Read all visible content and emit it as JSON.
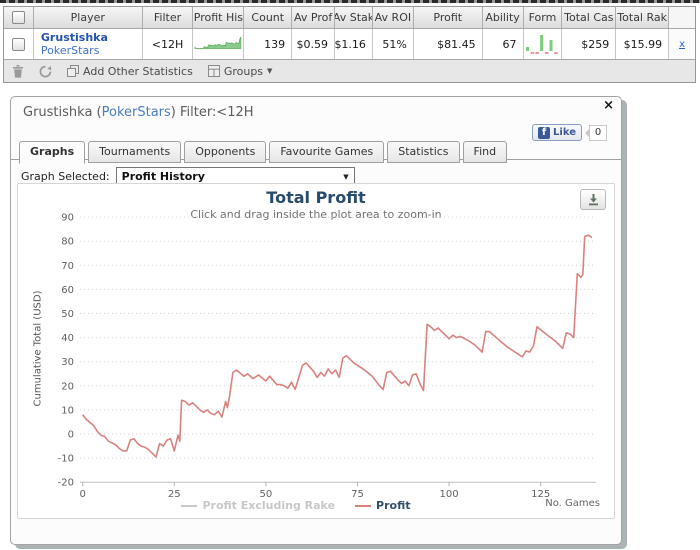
{
  "table": {
    "columns": [
      "Player",
      "Filter",
      "Profit His",
      "Count",
      "Av Prof",
      "Av Stak",
      "Av ROI",
      "Profit",
      "Ability",
      "Form",
      "Total Cas",
      "Total Rak"
    ],
    "row": {
      "player_name": "Grustishka",
      "player_site": "PokerStars",
      "filter": "<12H",
      "count": "139",
      "av_prof": "$0.59",
      "av_stak": "$1.16",
      "av_roi": "51%",
      "profit": "$81.45",
      "ability": "67",
      "total_cas": "$259",
      "total_rak": "$15.99",
      "remove_label": "x"
    },
    "form": [
      4,
      -2,
      -2,
      16,
      -2,
      11,
      -2
    ],
    "toolbar": {
      "add_other_statistics_label": "Add Other Statistics",
      "groups_label": "Groups",
      "groups_caret": "▼"
    }
  },
  "panel": {
    "title": {
      "prefix": "Grustishka (",
      "site": "PokerStars",
      "suffix": ") Filter:<12H"
    },
    "close_label": "×",
    "like": {
      "f": "f",
      "label": "Like",
      "count": "0"
    },
    "tabs": [
      "Graphs",
      "Tournaments",
      "Opponents",
      "Favourite Games",
      "Statistics",
      "Find"
    ],
    "active_tab": "Graphs",
    "graph_selector": {
      "label": "Graph Selected:",
      "value": "Profit History",
      "caret": "▼"
    }
  },
  "chart_data": {
    "type": "line",
    "title": "Total Profit",
    "subtitle": "Click and drag inside the plot area to zoom-in",
    "ylabel": "Cumulative Total (USD)",
    "xlabel_right": "No. Games",
    "ylim": [
      -20,
      90
    ],
    "xlim": [
      0,
      139
    ],
    "yticks": [
      -20,
      -10,
      0,
      10,
      20,
      30,
      40,
      50,
      60,
      70,
      80,
      90
    ],
    "xticks": [
      0,
      25,
      50,
      75,
      100,
      125
    ],
    "grid": "dotted",
    "legend_position": "bottom",
    "legend": [
      {
        "name": "Profit Excluding Rake",
        "color": "#c8c8c8",
        "text_color": "#c8c8c8",
        "disabled": true
      },
      {
        "name": "Profit",
        "color": "#d9827f",
        "text_color": "#33506b",
        "disabled": false
      }
    ],
    "series": [
      {
        "name": "Profit",
        "color": "#d9827f",
        "points": [
          [
            0,
            8
          ],
          [
            1,
            6
          ],
          [
            3,
            3.5
          ],
          [
            4,
            1
          ],
          [
            5,
            -0.5
          ],
          [
            6,
            -1
          ],
          [
            7,
            -3
          ],
          [
            9,
            -4.5
          ],
          [
            10,
            -6
          ],
          [
            11,
            -7
          ],
          [
            12,
            -7
          ],
          [
            13,
            -2.5
          ],
          [
            14,
            -2
          ],
          [
            15,
            -4
          ],
          [
            16,
            -5
          ],
          [
            17,
            -5.5
          ],
          [
            18,
            -6.5
          ],
          [
            19,
            -8
          ],
          [
            20,
            -9.5
          ],
          [
            21,
            -4
          ],
          [
            21.5,
            -4.5
          ],
          [
            22,
            -5
          ],
          [
            23,
            -2.5
          ],
          [
            24,
            -2
          ],
          [
            25,
            -7
          ],
          [
            26,
            -0.5
          ],
          [
            26.5,
            -3
          ],
          [
            27,
            14
          ],
          [
            28,
            13.5
          ],
          [
            29,
            12
          ],
          [
            30,
            13
          ],
          [
            31,
            11.5
          ],
          [
            32,
            10
          ],
          [
            33,
            9
          ],
          [
            34,
            10
          ],
          [
            35,
            8.5
          ],
          [
            36,
            8
          ],
          [
            37,
            9.5
          ],
          [
            38,
            7
          ],
          [
            39,
            13.5
          ],
          [
            39.5,
            11
          ],
          [
            40,
            15
          ],
          [
            41,
            25.5
          ],
          [
            42,
            26.5
          ],
          [
            44,
            24
          ],
          [
            45,
            25
          ],
          [
            46.5,
            23
          ],
          [
            48,
            24.5
          ],
          [
            50,
            22
          ],
          [
            51,
            24
          ],
          [
            53,
            20.5
          ],
          [
            54,
            20.5
          ],
          [
            55,
            20
          ],
          [
            56,
            19
          ],
          [
            57,
            21.5
          ],
          [
            58,
            18.5
          ],
          [
            60,
            28.5
          ],
          [
            61,
            29.5
          ],
          [
            63,
            26
          ],
          [
            64,
            23.5
          ],
          [
            65,
            25.5
          ],
          [
            66,
            24
          ],
          [
            67,
            27
          ],
          [
            68,
            25
          ],
          [
            69,
            26.5
          ],
          [
            70,
            23.5
          ],
          [
            71,
            31.5
          ],
          [
            72,
            32.5
          ],
          [
            74,
            29.5
          ],
          [
            77,
            26.5
          ],
          [
            79,
            24
          ],
          [
            81,
            20
          ],
          [
            82,
            18.5
          ],
          [
            83,
            25.5
          ],
          [
            84,
            26
          ],
          [
            86,
            22.5
          ],
          [
            87,
            21
          ],
          [
            88,
            22
          ],
          [
            89,
            20
          ],
          [
            90,
            24.5
          ],
          [
            91,
            25
          ],
          [
            92,
            21
          ],
          [
            93,
            18
          ],
          [
            94,
            45.5
          ],
          [
            95,
            44.5
          ],
          [
            96,
            43
          ],
          [
            97,
            44
          ],
          [
            99,
            41
          ],
          [
            100,
            39.5
          ],
          [
            101,
            41
          ],
          [
            102,
            40
          ],
          [
            103,
            40.5
          ],
          [
            105,
            39
          ],
          [
            107,
            37
          ],
          [
            109,
            34
          ],
          [
            110,
            42.5
          ],
          [
            111,
            42.5
          ],
          [
            114,
            38.5
          ],
          [
            116,
            36
          ],
          [
            119,
            33
          ],
          [
            120,
            32
          ],
          [
            121,
            34.5
          ],
          [
            122,
            34
          ],
          [
            123,
            36.5
          ],
          [
            124,
            44.5
          ],
          [
            126,
            42
          ],
          [
            129,
            38.5
          ],
          [
            131,
            35.5
          ],
          [
            132,
            42
          ],
          [
            133,
            41.5
          ],
          [
            134,
            40
          ],
          [
            135,
            66.5
          ],
          [
            136,
            65
          ],
          [
            136.5,
            66.2
          ],
          [
            137,
            82
          ],
          [
            138,
            82.5
          ],
          [
            139,
            81.5
          ]
        ]
      }
    ]
  }
}
